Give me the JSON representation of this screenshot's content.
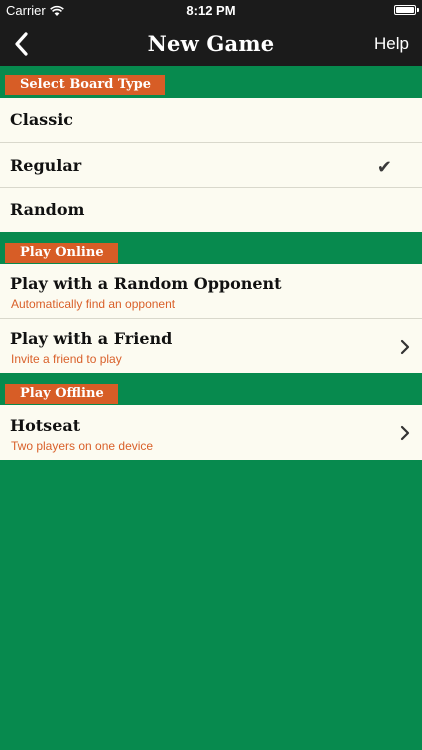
{
  "status_bar": {
    "carrier": "Carrier",
    "time": "8:12 PM"
  },
  "nav": {
    "title": "New Game",
    "help_label": "Help"
  },
  "sections": {
    "board_type": {
      "header": "Select Board Type",
      "items": [
        {
          "label": "Classic"
        },
        {
          "label": "Regular",
          "selected": true
        },
        {
          "label": "Random"
        }
      ]
    },
    "online": {
      "header": "Play Online",
      "items": [
        {
          "label": "Play with a Random Opponent",
          "subtitle": "Automatically find an opponent"
        },
        {
          "label": "Play with a Friend",
          "subtitle": "Invite a friend to play"
        }
      ]
    },
    "offline": {
      "header": "Play Offline",
      "items": [
        {
          "label": "Hotseat",
          "subtitle": "Two players on one device"
        }
      ]
    }
  },
  "icons": {
    "checkmark": "✔"
  },
  "colors": {
    "background": "#078a4e",
    "nav_bar": "#1b1b1b",
    "section_header": "#d75d26",
    "cell": "#fcfbf1",
    "subtitle": "#d9602a"
  }
}
